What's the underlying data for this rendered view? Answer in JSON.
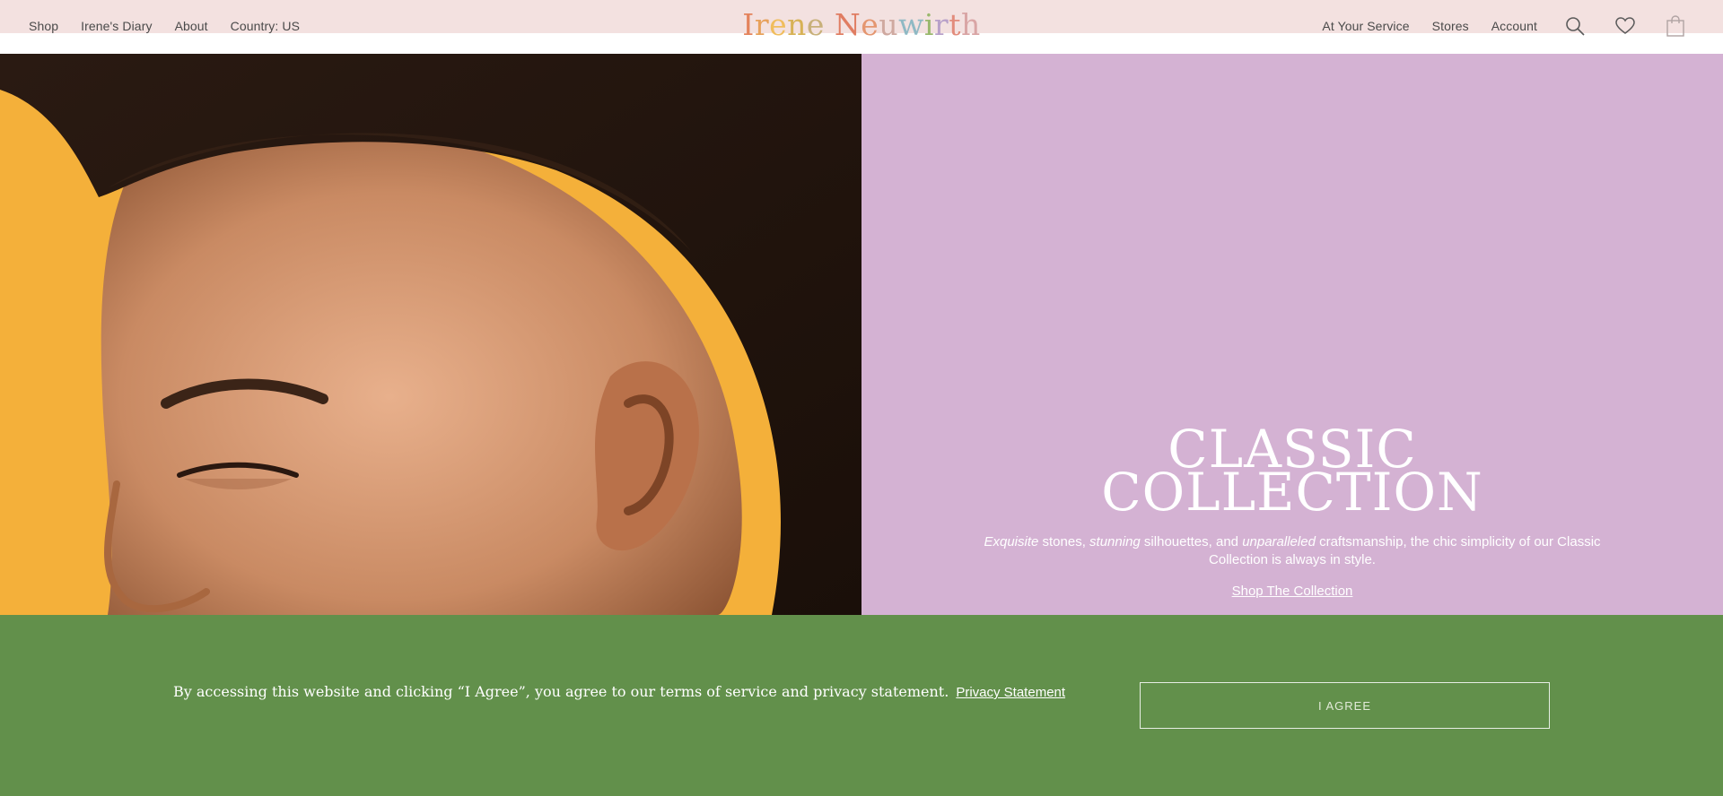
{
  "header": {
    "nav_left": [
      "Shop",
      "Irene's Diary",
      "About",
      "Country: US"
    ],
    "nav_right": [
      "At Your Service",
      "Stores",
      "Account"
    ],
    "logo": {
      "text": "Irene Neuwirth",
      "letter_colors": [
        "#e4835c",
        "#e7a15b",
        "#f0bd5d",
        "#d7b256",
        "#c8b07a",
        "#e07d62",
        "#e49670",
        "#cfa9a0",
        "#8fb9c4",
        "#9ab86d",
        "#b8a0c9",
        "#e28c7c",
        "#d9a5a5",
        "#c9a0c0"
      ]
    },
    "icons": [
      "search-icon",
      "heart-icon",
      "bag-icon"
    ]
  },
  "hero": {
    "image_bg_color": "#f4b03a",
    "panel_bg_color": "#d4b2d3",
    "title_line1": "CLASSIC",
    "title_line2": "COLLECTION",
    "desc": {
      "em1": "Exquisite",
      "t1": " stones, ",
      "em2": "stunning",
      "t2": " silhouettes, and ",
      "em3": "unparalleled",
      "t3": " craftsmanship, the chic simplicity of our Classic Collection is always in style."
    },
    "cta": "Shop The Collection"
  },
  "banner": {
    "bg_color": "#62904b",
    "text": "By accessing this website and clicking “I Agree”, you agree to our terms of service and privacy statement.",
    "privacy_link": "Privacy Statement",
    "agree_button": "I AGREE"
  }
}
